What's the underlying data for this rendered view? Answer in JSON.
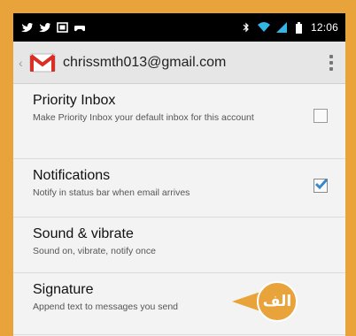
{
  "status_bar": {
    "time": "12:06",
    "left_icons": [
      "twitter-icon",
      "twitter-icon",
      "gallery-icon",
      "game-controller-icon"
    ],
    "right_icons": [
      "bluetooth-icon",
      "wifi-icon",
      "signal-icon",
      "battery-icon"
    ]
  },
  "action_bar": {
    "account": "chrissmth013@gmail.com",
    "logo": "gmail-icon",
    "menu": "overflow-menu-icon"
  },
  "settings": [
    {
      "title": "Priority Inbox",
      "subtitle": "Make Priority Inbox your default inbox for this account",
      "checked": false
    },
    {
      "title": "Notifications",
      "subtitle": "Notify in status bar when email arrives",
      "checked": true
    },
    {
      "title": "Sound & vibrate",
      "subtitle": "Sound on, vibrate, notify once"
    },
    {
      "title": "Signature",
      "subtitle": "Append text to messages you send"
    }
  ],
  "callout_badge": {
    "label": "الف"
  },
  "colors": {
    "frame": "#e8a33a",
    "check": "#3a87c8",
    "background": "#f3f3f3"
  }
}
